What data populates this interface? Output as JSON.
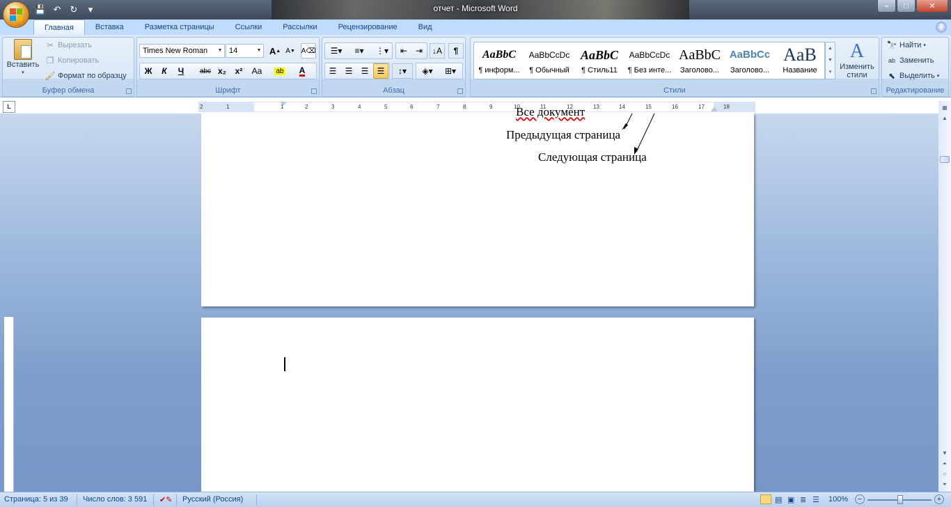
{
  "window": {
    "title": "отчет - Microsoft Word",
    "controls": {
      "minimize": "–",
      "maximize": "□",
      "close": "✕"
    }
  },
  "qat": [
    {
      "name": "save-icon",
      "glyph": "💾"
    },
    {
      "name": "undo-icon",
      "glyph": "↶"
    },
    {
      "name": "redo-icon",
      "glyph": "↻"
    },
    {
      "name": "customize-qat-icon",
      "glyph": "▾"
    }
  ],
  "tabs": [
    "Главная",
    "Вставка",
    "Разметка страницы",
    "Ссылки",
    "Рассылки",
    "Рецензирование",
    "Вид"
  ],
  "active_tab": "Главная",
  "groups": {
    "clipboard": {
      "title": "Буфер обмена",
      "paste": "Вставить",
      "cut": "Вырезать",
      "copy": "Копировать",
      "format_painter": "Формат по образцу"
    },
    "font": {
      "title": "Шрифт",
      "font_name": "Times New Roman",
      "font_size": "14",
      "bold": "Ж",
      "italic": "К",
      "underline": "Ч",
      "strike": "abc",
      "subscript": "x₂",
      "superscript": "x²",
      "case": "Aa",
      "grow": "A",
      "shrink": "A"
    },
    "paragraph": {
      "title": "Абзац"
    },
    "styles": {
      "title": "Стили",
      "tiles": [
        {
          "sample": "AaBbC",
          "name": "¶ информ..."
        },
        {
          "sample": "AaBbCcDc",
          "name": "¶ Обычный"
        },
        {
          "sample": "AaBbC",
          "name": "¶ Стиль11"
        },
        {
          "sample": "AaBbCcDc",
          "name": "¶ Без инте..."
        },
        {
          "sample": "AaBbC",
          "name": "Заголово..."
        },
        {
          "sample": "AaBbCc",
          "name": "Заголово..."
        },
        {
          "sample": "AaB",
          "name": "Название"
        }
      ],
      "change_styles_line1": "Изменить",
      "change_styles_line2": "стили"
    },
    "editing": {
      "title": "Редактирование",
      "find": "Найти",
      "replace": "Заменить",
      "select": "Выделить"
    }
  },
  "ruler": {
    "ticks": [
      "2",
      "1",
      "1",
      "2",
      "3",
      "4",
      "5",
      "6",
      "7",
      "8",
      "9",
      "10",
      "11",
      "12",
      "13",
      "14",
      "15",
      "16",
      "17",
      "18"
    ]
  },
  "document": {
    "page1_lines": [
      "Все документ",
      "Предыдущая страница",
      "Следующая страница"
    ]
  },
  "status": {
    "page": "Страница: 5 из 39",
    "words": "Число слов: 3 591",
    "language": "Русский (Россия)",
    "zoom": "100%"
  }
}
